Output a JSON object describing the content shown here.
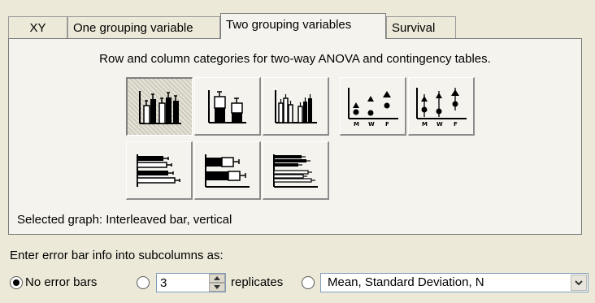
{
  "tabs": [
    {
      "label": "XY",
      "active": false
    },
    {
      "label": "One grouping variable",
      "active": false
    },
    {
      "label": "Two grouping variables",
      "active": true
    },
    {
      "label": "Survival",
      "active": false
    }
  ],
  "panel": {
    "caption": "Row and column categories for two-way ANOVA and contingency tables.",
    "graph_buttons": [
      {
        "icon": "interleaved-bar-vertical-icon",
        "selected": true
      },
      {
        "icon": "stacked-bar-vertical-icon",
        "selected": false
      },
      {
        "icon": "grouped-bar-vertical-icon",
        "selected": false
      },
      {
        "icon": "scatter-groups-icon",
        "selected": false,
        "labels": [
          "M",
          "W",
          "F"
        ]
      },
      {
        "icon": "scatter-errorbars-icon",
        "selected": false,
        "labels": [
          "M",
          "W",
          "F"
        ]
      },
      {
        "icon": "interleaved-bar-horizontal-icon",
        "selected": false
      },
      {
        "icon": "stacked-bar-horizontal-icon",
        "selected": false
      },
      {
        "icon": "grouped-bar-horizontal-icon",
        "selected": false
      }
    ],
    "selected_graph": "Selected graph:  Interleaved bar, vertical"
  },
  "error_bars": {
    "label": "Enter error bar info into subcolumns as:",
    "option_none": "No error bars",
    "replicates_value": "3",
    "replicates_label": "replicates",
    "format_value": "Mean, Standard Deviation, N",
    "selected_option": "none"
  }
}
